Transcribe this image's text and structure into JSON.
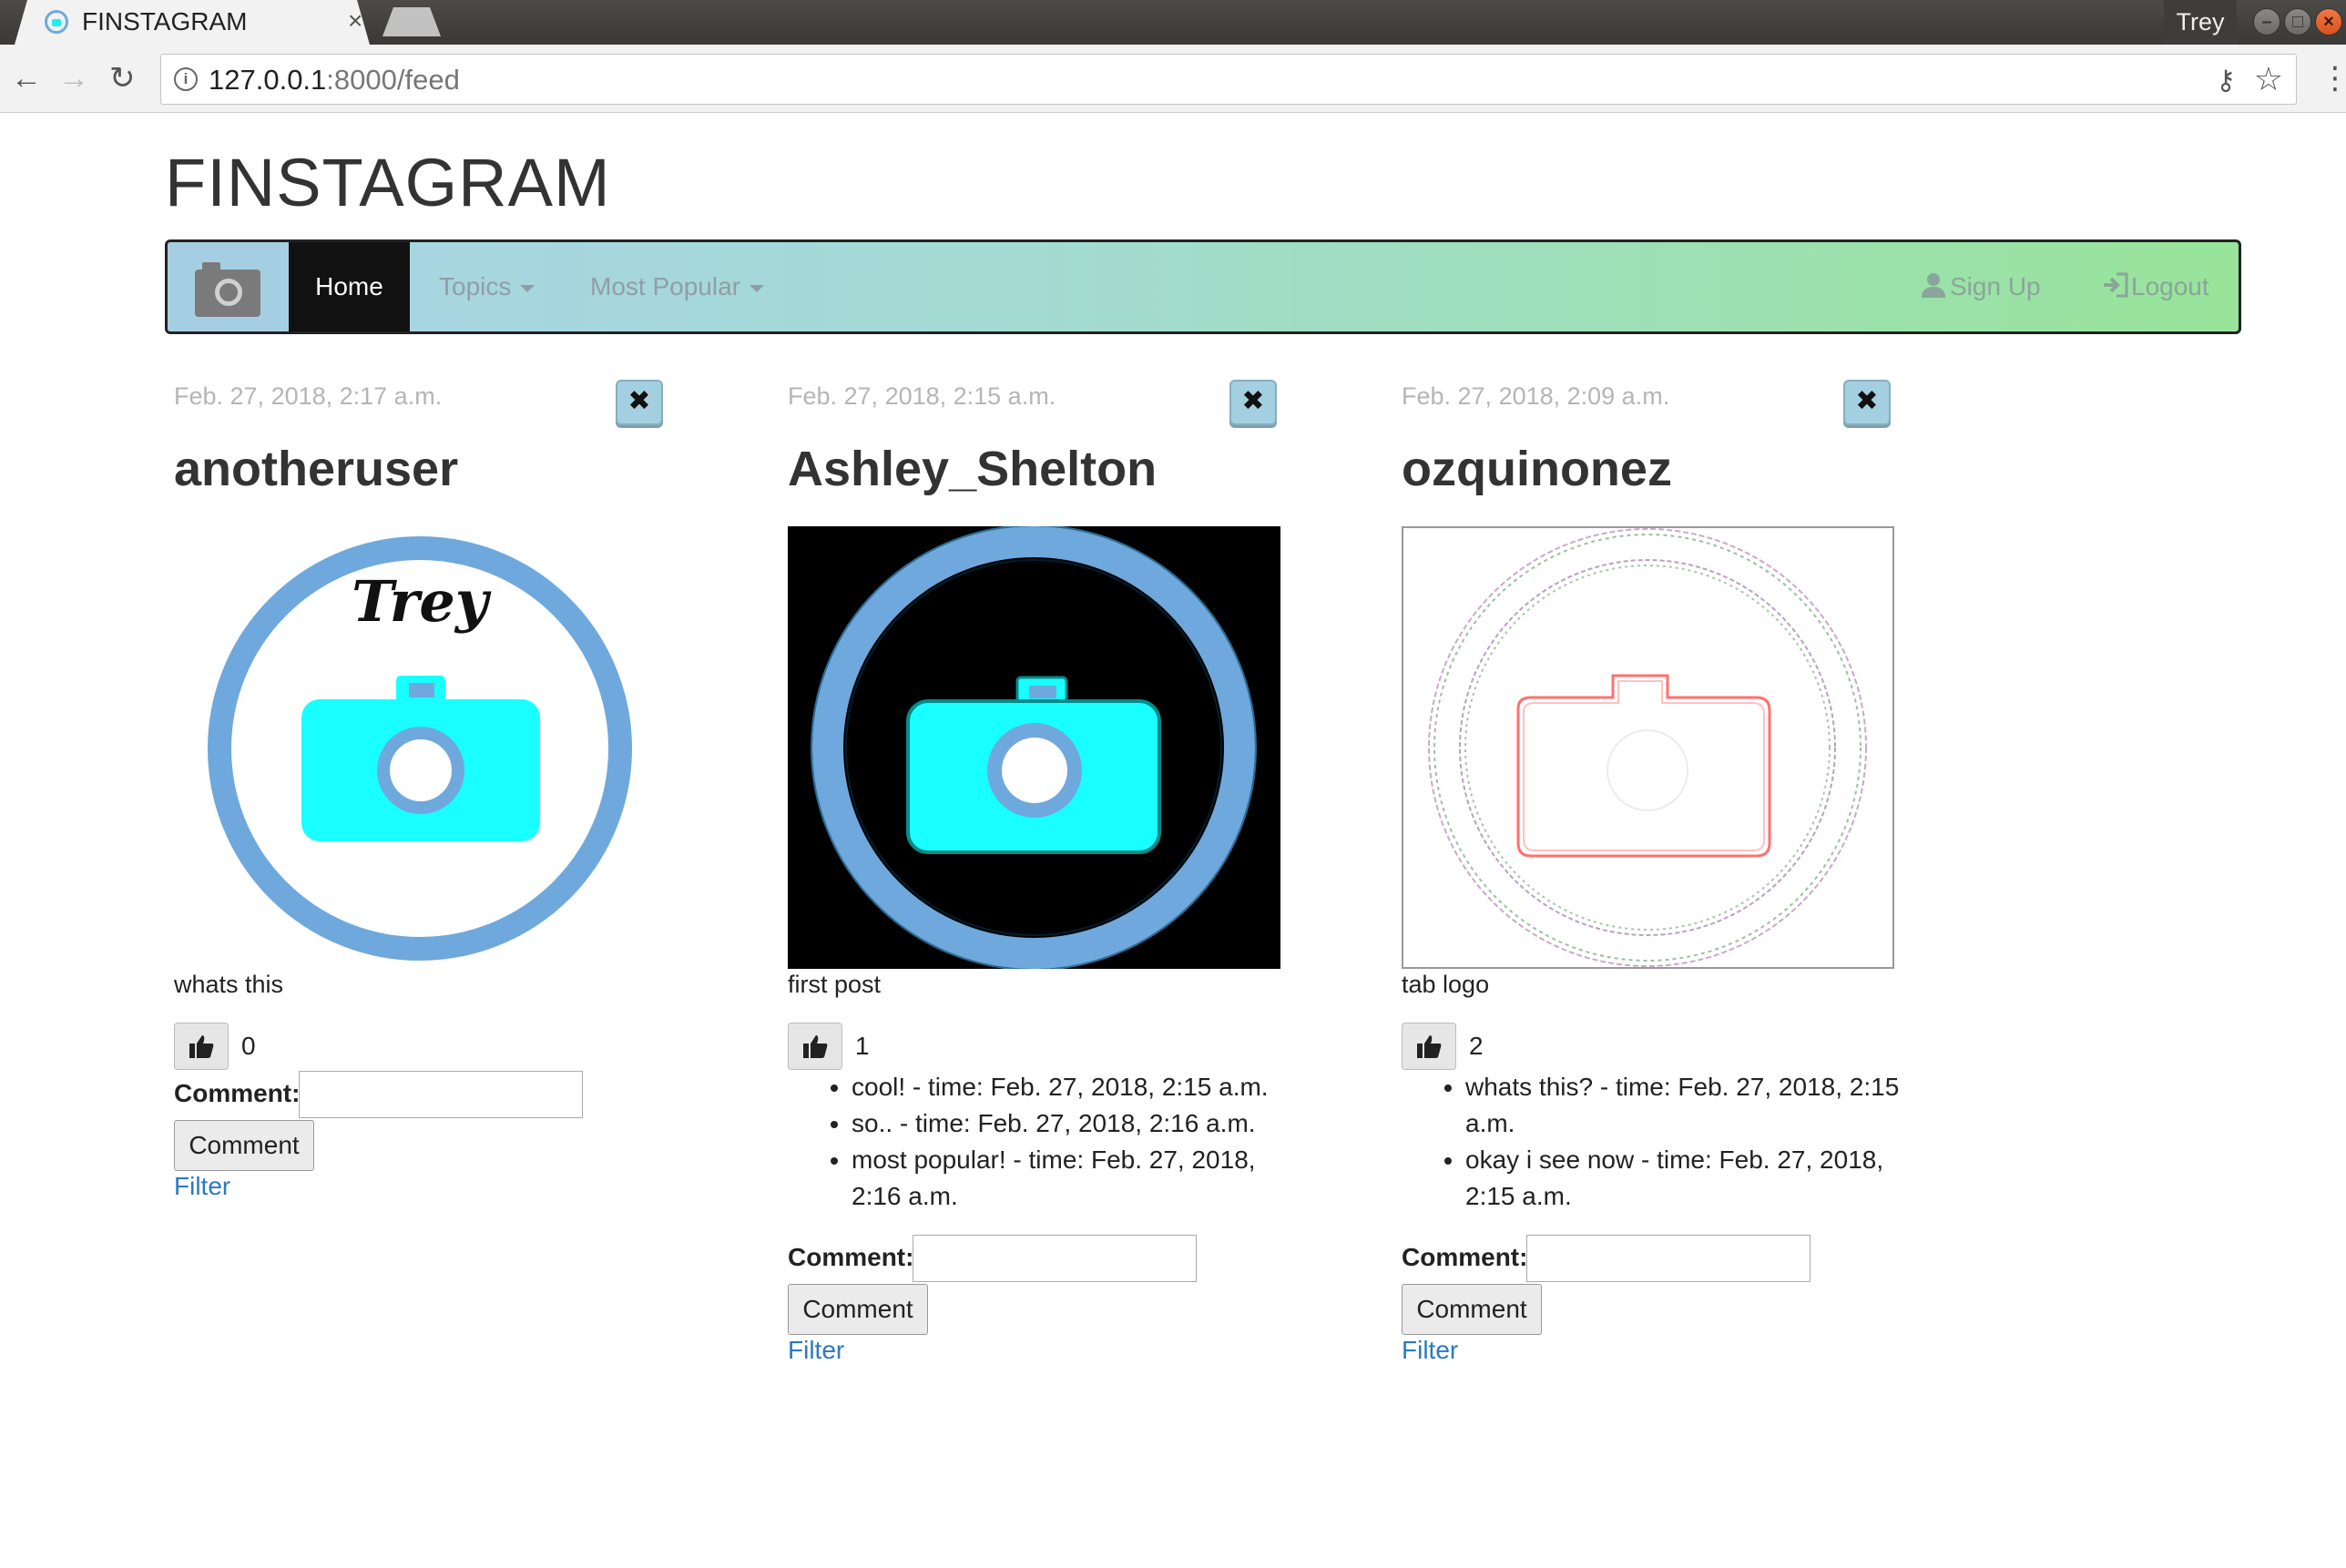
{
  "browser": {
    "tab_title": "FINSTAGRAM",
    "tab_close": "×",
    "profile_name": "Trey",
    "url_host": "127.0.0.1",
    "url_path": ":8000/feed",
    "info_icon": "i",
    "key_icon": "key-icon",
    "star_icon": "star-icon"
  },
  "site": {
    "brand": "FINSTAGRAM",
    "nav": {
      "home": "Home",
      "topics": "Topics",
      "most_popular": "Most Popular",
      "sign_up": "Sign Up",
      "logout": "Logout"
    },
    "colors": {
      "navbar_start": "#a9d3e6",
      "navbar_end": "#98e49a",
      "link": "#2a7ac2",
      "camera_cyan": "#19ffff",
      "ring_blue": "#6fa8dc"
    }
  },
  "posts": [
    {
      "date": "Feb. 27, 2018, 2:17 a.m.",
      "user": "anotheruser",
      "image_style": "white",
      "image_text": "Trey",
      "caption": "whats this",
      "likes": "0",
      "comments": [],
      "comment_label": "Comment:",
      "comment_button": "Comment",
      "filter": "Filter",
      "delete_symbol": "✖"
    },
    {
      "date": "Feb. 27, 2018, 2:15 a.m.",
      "user": "Ashley_Shelton",
      "image_style": "black",
      "caption": "first post",
      "likes": "1",
      "comments": [
        "cool! - time: Feb. 27, 2018, 2:15 a.m.",
        "so.. - time: Feb. 27, 2018, 2:16 a.m.",
        "most popular! - time: Feb. 27, 2018, 2:16 a.m."
      ],
      "comment_label": "Comment:",
      "comment_button": "Comment",
      "filter": "Filter",
      "delete_symbol": "✖"
    },
    {
      "date": "Feb. 27, 2018, 2:09 a.m.",
      "user": "ozquinonez",
      "image_style": "edges",
      "caption": "tab logo",
      "likes": "2",
      "comments": [
        "whats this? - time: Feb. 27, 2018, 2:15 a.m.",
        "okay i see now - time: Feb. 27, 2018, 2:15 a.m."
      ],
      "comment_label": "Comment:",
      "comment_button": "Comment",
      "filter": "Filter",
      "delete_symbol": "✖"
    }
  ]
}
